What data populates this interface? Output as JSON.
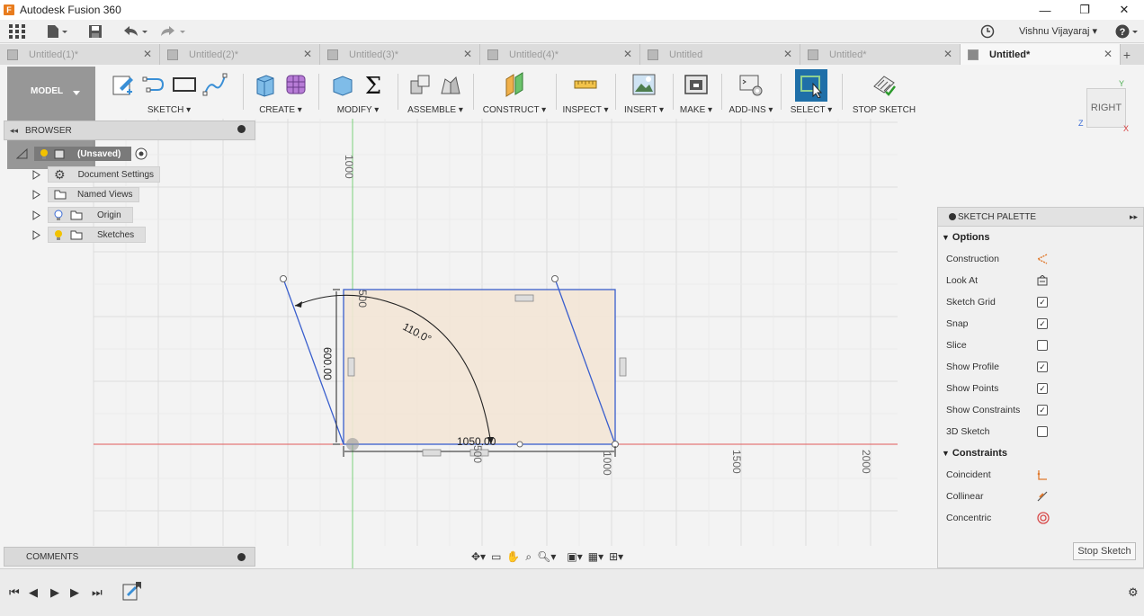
{
  "window": {
    "title": "Autodesk Fusion 360",
    "app_icon": "F"
  },
  "user": {
    "name": "Vishnu Vijayaraj ▾"
  },
  "tabs": [
    {
      "label": "Untitled(1)*"
    },
    {
      "label": "Untitled(2)*"
    },
    {
      "label": "Untitled(3)*"
    },
    {
      "label": "Untitled(4)*"
    },
    {
      "label": "Untitled"
    },
    {
      "label": "Untitled*"
    },
    {
      "label": "Untitled*"
    }
  ],
  "workspace": {
    "label": "MODEL"
  },
  "ribbon": {
    "groups": [
      {
        "label": "SKETCH ▾"
      },
      {
        "label": "CREATE ▾"
      },
      {
        "label": "MODIFY ▾"
      },
      {
        "label": "ASSEMBLE ▾"
      },
      {
        "label": "CONSTRUCT ▾"
      },
      {
        "label": "INSPECT ▾"
      },
      {
        "label": "INSERT ▾"
      },
      {
        "label": "MAKE ▾"
      },
      {
        "label": "ADD-INS ▾"
      },
      {
        "label": "SELECT ▾"
      },
      {
        "label": "STOP SKETCH"
      }
    ]
  },
  "browser": {
    "title": "BROWSER",
    "root": "(Unsaved)",
    "items": [
      {
        "label": "Document Settings"
      },
      {
        "label": "Named Views"
      },
      {
        "label": "Origin"
      },
      {
        "label": "Sketches"
      }
    ]
  },
  "viewcube": {
    "face": "RIGHT",
    "axis_y": "Y",
    "axis_z": "Z",
    "axis_x": "X"
  },
  "canvas": {
    "axis_labels": {
      "v1000": "1000",
      "h500": "500",
      "h1000": "1000",
      "h1500": "1500",
      "h2000": "2000"
    },
    "dimensions": {
      "height": "600.00",
      "width": "1050.00",
      "angle": "110.0°",
      "top": "500"
    }
  },
  "palette": {
    "title": "SKETCH PALETTE",
    "options_header": "Options",
    "options": [
      {
        "label": "Construction",
        "control": "construction-icon"
      },
      {
        "label": "Look At",
        "control": "look-at-icon"
      },
      {
        "label": "Sketch Grid",
        "checked": true
      },
      {
        "label": "Snap",
        "checked": true
      },
      {
        "label": "Slice",
        "checked": false
      },
      {
        "label": "Show Profile",
        "checked": true
      },
      {
        "label": "Show Points",
        "checked": true
      },
      {
        "label": "Show Constraints",
        "checked": true
      },
      {
        "label": "3D Sketch",
        "checked": false
      }
    ],
    "constraints_header": "Constraints",
    "constraints": [
      {
        "label": "Coincident",
        "control": "coincident-icon"
      },
      {
        "label": "Collinear",
        "control": "collinear-icon"
      },
      {
        "label": "Concentric",
        "control": "concentric-icon"
      }
    ],
    "stop_button": "Stop Sketch"
  },
  "comments": {
    "title": "COMMENTS"
  },
  "colors": {
    "accent": "#0696d7",
    "profile_fill": "#f3e5d6",
    "sketch_line": "#3a5fcd",
    "axis_red": "#e05a5a",
    "axis_green": "#7bd07b"
  }
}
